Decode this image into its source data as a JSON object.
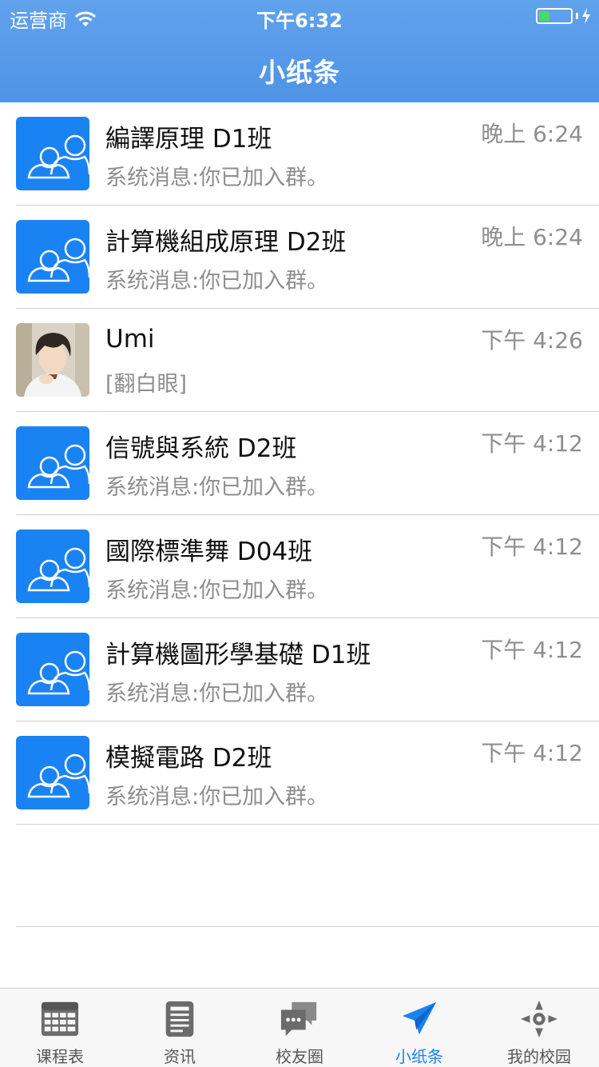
{
  "status_bar": {
    "carrier": "运营商",
    "time": "下午6:32",
    "battery_level": 0.35
  },
  "header": {
    "title": "小纸条"
  },
  "conversations": [
    {
      "name": "編譯原理 D1班",
      "message": "系统消息:你已加入群。",
      "time": "晚上 6:24",
      "avatar": "group-icon"
    },
    {
      "name": "計算機組成原理 D2班",
      "message": "系统消息:你已加入群。",
      "time": "晚上 6:24",
      "avatar": "group-icon"
    },
    {
      "name": "Umi",
      "message": "[翻白眼]",
      "time": "下午 4:26",
      "avatar": "user-photo"
    },
    {
      "name": "信號與系統 D2班",
      "message": "系统消息:你已加入群。",
      "time": "下午 4:12",
      "avatar": "group-icon"
    },
    {
      "name": "國際標準舞 D04班",
      "message": "系统消息:你已加入群。",
      "time": "下午 4:12",
      "avatar": "group-icon"
    },
    {
      "name": "計算機圖形學基礎 D1班",
      "message": "系统消息:你已加入群。",
      "time": "下午 4:12",
      "avatar": "group-icon"
    },
    {
      "name": "模擬電路 D2班",
      "message": "系统消息:你已加入群。",
      "time": "下午 4:12",
      "avatar": "group-icon"
    }
  ],
  "tabbar": {
    "items": [
      {
        "label": "课程表",
        "icon": "calendar-grid-icon"
      },
      {
        "label": "资讯",
        "icon": "news-icon"
      },
      {
        "label": "校友圈",
        "icon": "chat-bubbles-icon"
      },
      {
        "label": "小纸条",
        "icon": "paper-plane-icon",
        "active": true
      },
      {
        "label": "我的校园",
        "icon": "compass-icon"
      }
    ]
  },
  "colors": {
    "header": "#5b9de9",
    "accent": "#1a83f3",
    "battery": "#4cd964"
  }
}
